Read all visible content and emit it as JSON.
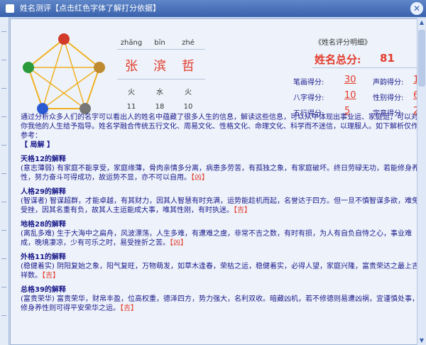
{
  "window": {
    "title": "姓名测评【点击红色字体了解打分依据】"
  },
  "names": {
    "pinyin": [
      "zhāng",
      "bīn",
      "zhé"
    ],
    "hanzi": [
      "张",
      "滨",
      "哲"
    ],
    "elements": [
      "火",
      "水",
      "火"
    ],
    "strokes": [
      "11",
      "18",
      "10"
    ]
  },
  "score": {
    "header": "《姓名评分明细》",
    "total_label": "姓名总分:",
    "total_value": "81",
    "items": [
      {
        "label": "笔画得分:",
        "value": "30"
      },
      {
        "label": "声韵得分:",
        "value": "10"
      },
      {
        "label": "八字得分:",
        "value": "10"
      },
      {
        "label": "性别得分:",
        "value": "6"
      },
      {
        "label": "五行得分:",
        "value": "5"
      },
      {
        "label": "字意得分:",
        "value": "20"
      }
    ]
  },
  "body": {
    "intro": "通过分析众多人们的名字可以看出人的姓名中蕴藏了很多人生的信息，解读这些信息，可以从中体现出事业运、家庭运，可以对你我他的人生给予指导。姓名学融合传统五行文化、周易文化、性格文化、命理文化、科学而不迷信，以理服人。如下解析仅作参考：",
    "section_header": "【 局解 】",
    "sections": [
      {
        "title": "天格12的解释",
        "text": "(意志薄弱) 有家庭不能享受，家庭缘薄，骨肉亲情多分离，病患多劳苦，有孤独之象，有家庭破坏。终日劳碌无功，若能修身养性，努力奋斗可得成功，故运势不显，亦不可以自用。",
        "luck": "【凶】"
      },
      {
        "title": "人格29的解释",
        "text": "(智谋者) 智谋超群，才能卓越，有其财力，因其人智慧有时充满，运势能趁机而起，名誉达于四方。但一旦不慎智谋多欲，难免受挫，因其名重有负，故其人主运能成大事，唯其性刚，有时执迷。",
        "luck": "【吉】"
      },
      {
        "title": "地格28的解释",
        "text": "(离乱多难) 生于大海中之扁舟，风波漂荡，人生多难，有遭难之虞，非常不吉之数，有时有损，为人有自负自恃之心，事业难成，晚境凄凉，少有可乐之时，易受挫折之苦。",
        "luck": "【凶】"
      },
      {
        "title": "外格11的解释",
        "text": "(稳健着实) 阴阳复始之象，阳气复旺，万物萌发，如草木逢春，荣枯之运，稳健着实，必得人望，家庭兴隆，富贵荣达之最上吉祥数。",
        "luck": "【吉】"
      },
      {
        "title": "总格39的解释",
        "text": "(富贵荣华) 富贵荣华，财帛丰盈，位高权重，德泽四方，势力强大，名利双收。暗藏凶机，若不修德则易遭凶祸，宜谨慎处事，修身养性则可得平安荣华之运。",
        "luck": "【吉】"
      }
    ]
  }
}
